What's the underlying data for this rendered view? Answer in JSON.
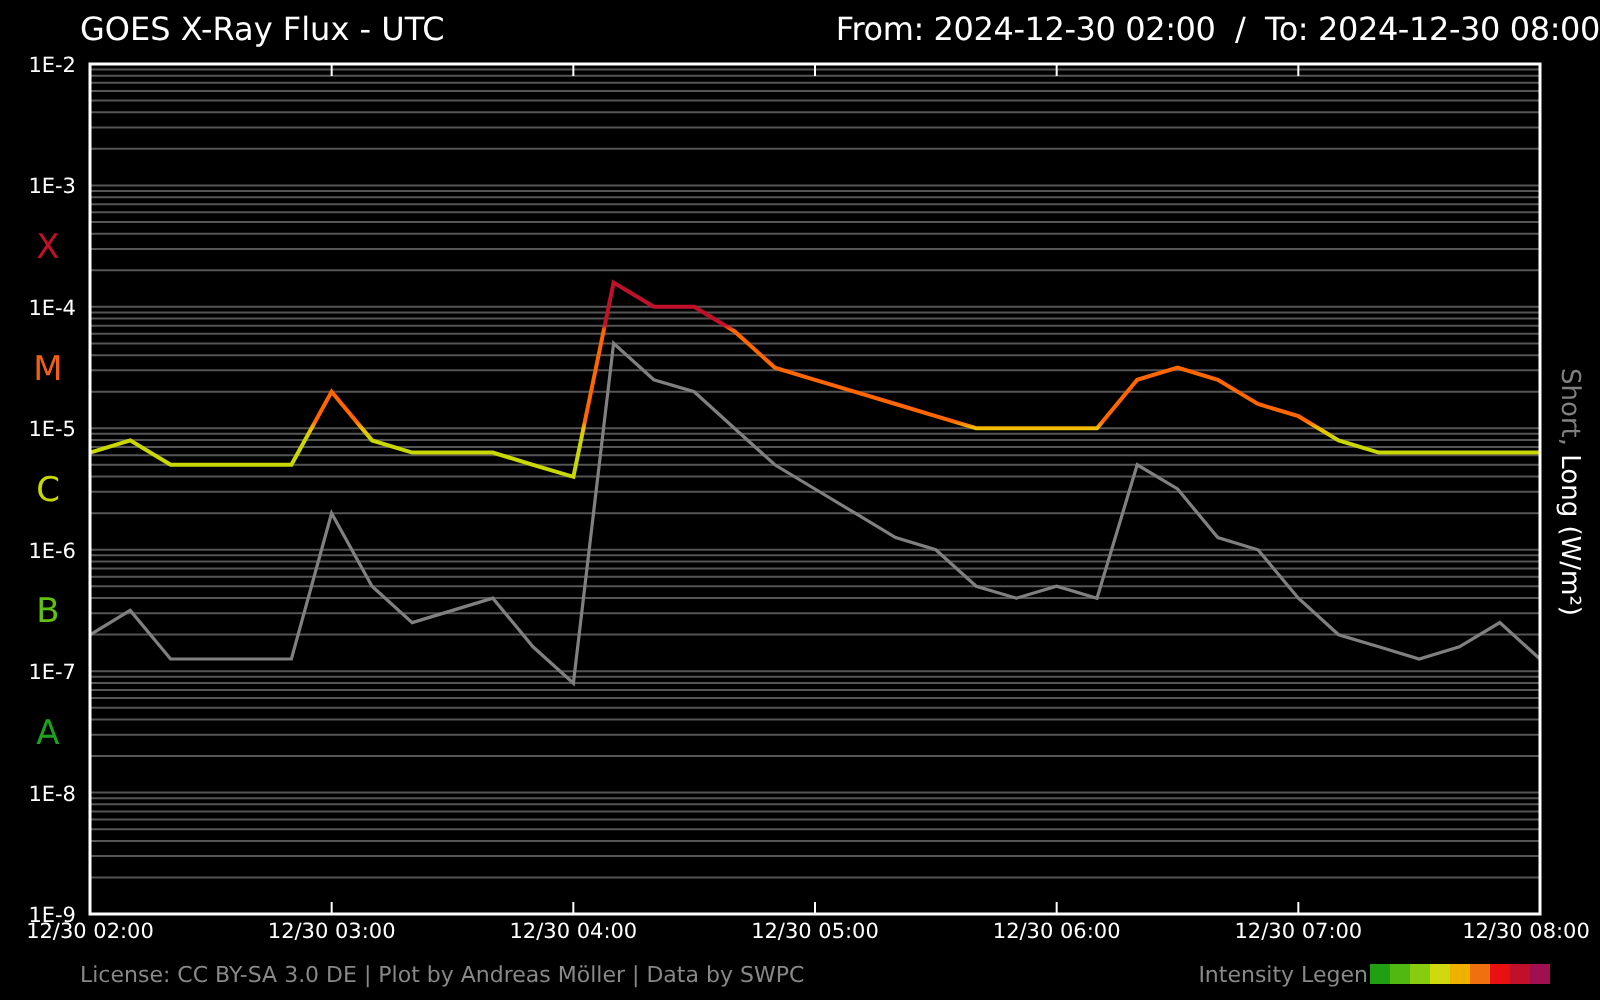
{
  "header": {
    "title": "GOES X-Ray Flux - UTC",
    "range": "From: 2024-12-30 02:00  /  To: 2024-12-30 08:00"
  },
  "chart": {
    "flare_classes": [
      {
        "label": "X",
        "color": "#c0102a"
      },
      {
        "label": "M",
        "color": "#f06010"
      },
      {
        "label": "C",
        "color": "#c8d800"
      },
      {
        "label": "B",
        "color": "#60c010"
      },
      {
        "label": "A",
        "color": "#20a020"
      }
    ],
    "y_axis_labels": [
      "1E-2",
      "1E-3",
      "1E-4",
      "1E-5",
      "1E-6",
      "1E-7",
      "1E-8",
      "1E-9"
    ],
    "x_axis_labels": [
      "12/30 02:00",
      "12/30 03:00",
      "12/30 04:00",
      "12/30 05:00",
      "12/30 06:00",
      "12/30 07:00",
      "12/30 08:00"
    ],
    "axis_label": [
      {
        "text": "Short,",
        "color": "#808080"
      },
      {
        "text": "Long (W/m²)",
        "color": "#ffffff"
      }
    ]
  },
  "footer": {
    "credits": "License: CC BY-SA 3.0 DE | Plot by Andreas Möller | Data by SWPC",
    "legend_label": "Intensity Legen",
    "legend_colors": [
      {
        "color": "#20a010"
      },
      {
        "color": "#50b810"
      },
      {
        "color": "#88cc10"
      },
      {
        "color": "#d0d810"
      },
      {
        "color": "#f0b000"
      },
      {
        "color": "#f07010"
      },
      {
        "color": "#e81010"
      },
      {
        "color": "#c0102a"
      },
      {
        "color": "#a01050"
      }
    ]
  }
}
